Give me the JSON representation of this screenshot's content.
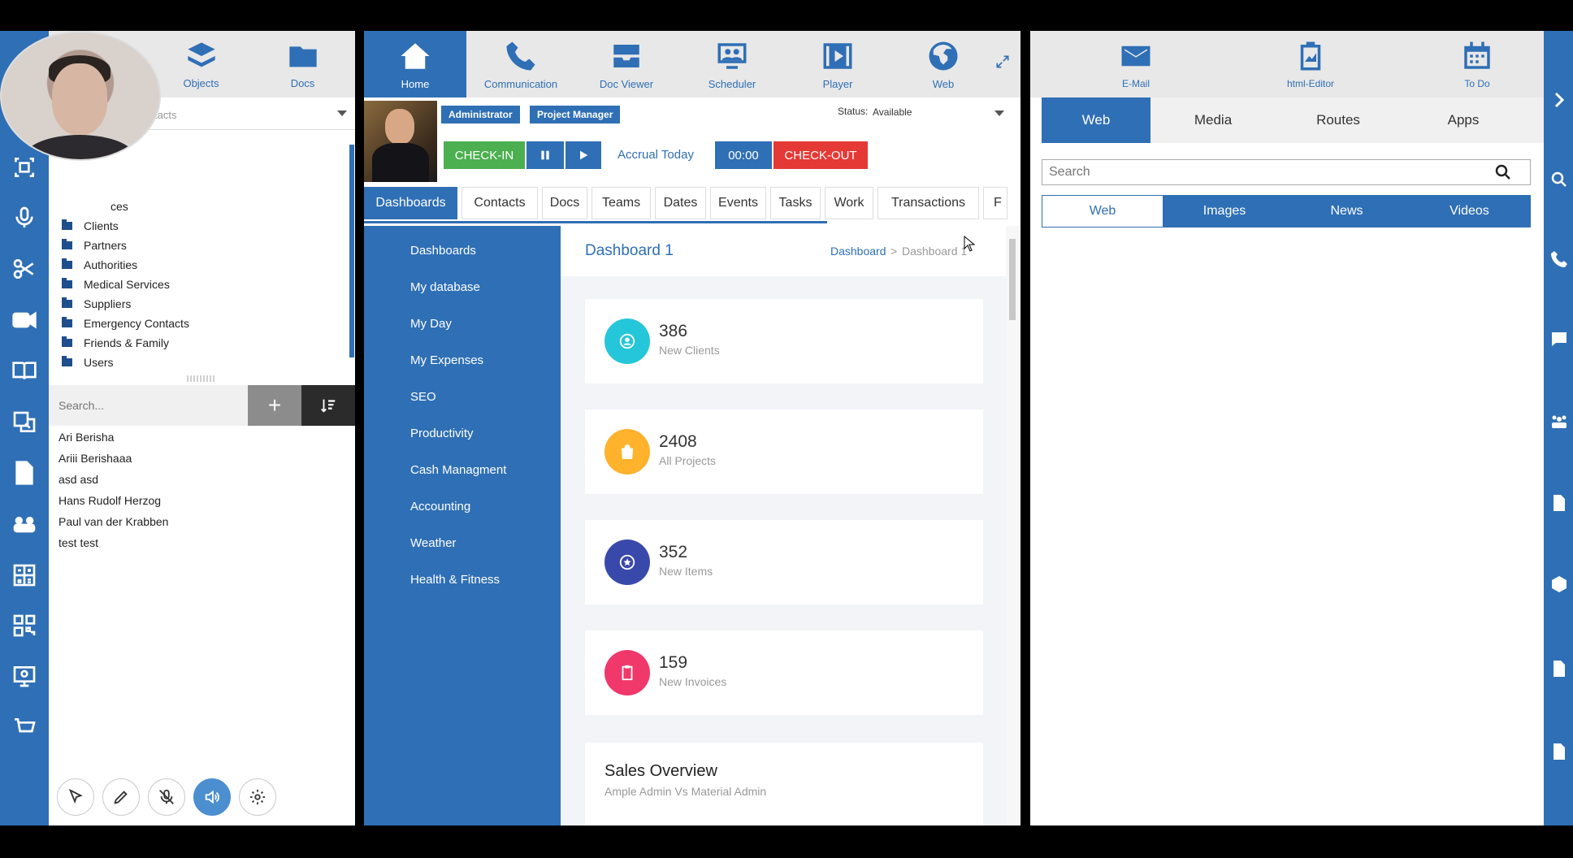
{
  "contacts_panel": {
    "topbar": [
      {
        "label": "Objects",
        "icon": "layers-icon"
      },
      {
        "label": "Docs",
        "icon": "folder-icon"
      }
    ],
    "dropdown_placeholder": "tacts",
    "tree": [
      "ces",
      "Clients",
      "Partners",
      "Authorities",
      "Medical Services",
      "Suppliers",
      "Emergency Contacts",
      "Friends & Family",
      "Users"
    ],
    "search_placeholder": "Search...",
    "add_label": "+",
    "contacts": [
      "Ari Berisha",
      "Ariii Berishaaa",
      "asd asd",
      "Hans Rudolf Herzog",
      "Paul van der Krabben",
      "test test"
    ]
  },
  "center": {
    "nav": [
      {
        "label": "Home",
        "icon": "home-icon"
      },
      {
        "label": "Communication",
        "icon": "phone-icon"
      },
      {
        "label": "Doc Viewer",
        "icon": "inbox-icon"
      },
      {
        "label": "Scheduler",
        "icon": "people-board-icon"
      },
      {
        "label": "Player",
        "icon": "film-icon"
      },
      {
        "label": "Web",
        "icon": "globe-icon"
      }
    ],
    "roles": [
      "Administrator",
      "Project Manager"
    ],
    "status_label": "Status:",
    "status_value": "Available",
    "checkin_label": "CHECK-IN",
    "accrual_label": "Accrual Today",
    "timer": "00:00",
    "checkout_label": "CHECK-OUT",
    "tabs": [
      "Dashboards",
      "Contacts",
      "Docs",
      "Teams",
      "Dates",
      "Events",
      "Tasks",
      "Work",
      "Transactions",
      "F"
    ],
    "sidebar": [
      "Dashboards",
      "My database",
      "My Day",
      "My Expenses",
      "SEO",
      "Productivity",
      "Cash Managment",
      "Accounting",
      "Weather",
      "Health & Fitness"
    ],
    "dashboard": {
      "title": "Dashboard 1",
      "breadcrumb_link": "Dashboard",
      "breadcrumb_sep": ">",
      "breadcrumb_current": "Dashboard 1",
      "stats": [
        {
          "value": "386",
          "label": "New Clients",
          "color": "#26c6da",
          "icon": "user-icon"
        },
        {
          "value": "2408",
          "label": "All Projects",
          "color": "#ffb22b",
          "icon": "bag-icon"
        },
        {
          "value": "352",
          "label": "New Items",
          "color": "#3949ab",
          "icon": "star-icon"
        },
        {
          "value": "159",
          "label": "New Invoices",
          "color": "#f0386b",
          "icon": "clipboard-icon"
        }
      ],
      "sales_title": "Sales Overview",
      "sales_subtitle": "Ample Admin Vs Material Admin"
    }
  },
  "right": {
    "topbar": [
      {
        "label": "E-Mail",
        "icon": "mail-icon"
      },
      {
        "label": "html-Editor",
        "icon": "clipboard-chart-icon"
      },
      {
        "label": "To Do",
        "icon": "calendar-icon"
      }
    ],
    "tabs": [
      "Web",
      "Media",
      "Routes",
      "Apps"
    ],
    "search_placeholder": "Search",
    "subtabs": [
      "Web",
      "Images",
      "News",
      "Videos"
    ]
  },
  "colors": {
    "primary": "#2f6fb5",
    "checkin": "#4caf50",
    "checkout": "#e53935"
  }
}
